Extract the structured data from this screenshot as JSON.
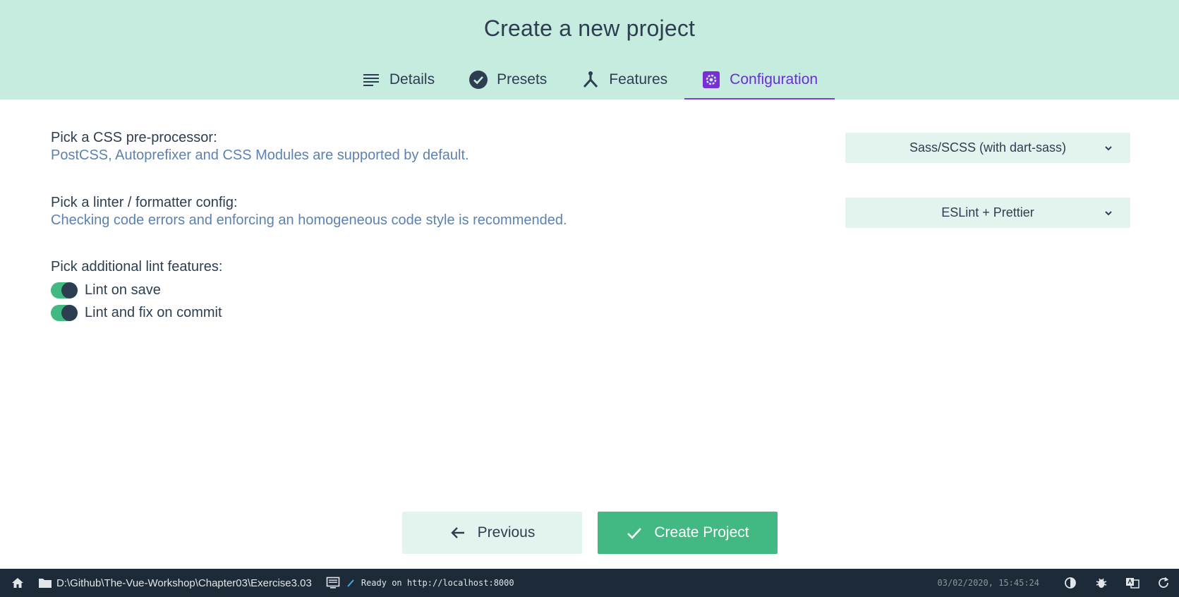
{
  "header": {
    "title": "Create a new project",
    "tabs": [
      {
        "label": "Details",
        "icon": "list-icon"
      },
      {
        "label": "Presets",
        "icon": "check-circle-icon"
      },
      {
        "label": "Features",
        "icon": "fork-icon"
      },
      {
        "label": "Configuration",
        "icon": "gear-icon",
        "active": true
      }
    ]
  },
  "config": {
    "css": {
      "label": "Pick a CSS pre-processor:",
      "desc": "PostCSS, Autoprefixer and CSS Modules are supported by default.",
      "value": "Sass/SCSS (with dart-sass)"
    },
    "linter": {
      "label": "Pick a linter / formatter config:",
      "desc": "Checking code errors and enforcing an homogeneous code style is recommended.",
      "value": "ESLint + Prettier"
    },
    "lint": {
      "label": "Pick additional lint features:",
      "options": [
        {
          "label": "Lint on save",
          "checked": true
        },
        {
          "label": "Lint and fix on commit",
          "checked": true
        }
      ]
    }
  },
  "actions": {
    "previous": "Previous",
    "create": "Create Project"
  },
  "statusbar": {
    "path": "D:\\Github\\The-Vue-Workshop\\Chapter03\\Exercise3.03",
    "log": "Ready on http://localhost:8000",
    "time": "03/02/2020, 15:45:24"
  },
  "colors": {
    "header_bg": "#c6ebdf",
    "accent": "#42b983",
    "active_tab": "#6a2fd4",
    "statusbar_bg": "#1d2b38"
  }
}
